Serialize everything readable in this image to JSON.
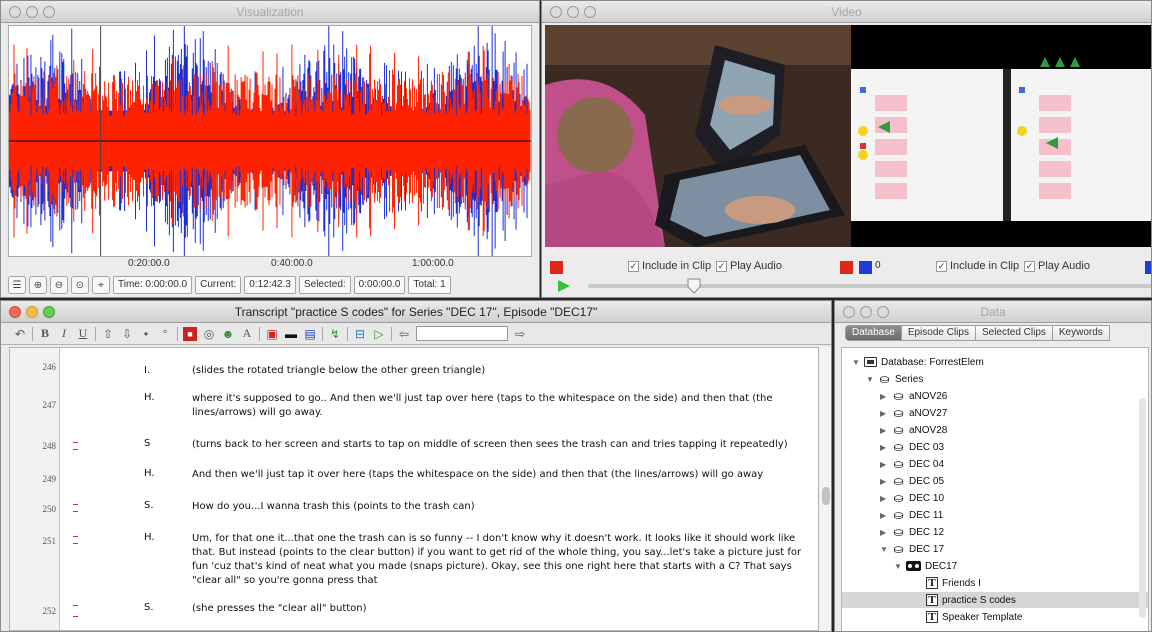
{
  "visualization": {
    "title": "Visualization",
    "ticks": [
      "0:20:00.0",
      "0:40:00.0",
      "1:00:00.0"
    ],
    "time_label": "Time: 0:00:00.0",
    "current_label": "Current:",
    "current_value": "0:12:42.3",
    "selected_label": "Selected:",
    "selected_value": "0:00:00.0",
    "total_label": "Total: 1",
    "colors": {
      "channel1": "#ff2200",
      "channel2": "#1a2fd6"
    }
  },
  "video": {
    "title": "Video",
    "include_clip": "Include in Clip",
    "play_audio": "Play Audio",
    "counter": "0",
    "colors": {
      "red": "#e1261c",
      "blue": "#1f3dd6"
    }
  },
  "transcript": {
    "title": "Transcript \"practice S codes\" for Series \"DEC 17\", Episode \"DEC17\"",
    "rows": [
      {
        "num": "246",
        "speaker": "I.",
        "text": "(slides the rotated triangle below the other green triangle)",
        "marked": false
      },
      {
        "num": "247",
        "speaker": "H.",
        "text": "where it's supposed to go.. And then we'll just tap over here (taps to the whitespace on the side) and then that (the lines/arrows) will go away.",
        "marked": false
      },
      {
        "num": "248",
        "speaker": "S",
        "text": "(turns back to her screen and starts to tap on middle of screen then sees the trash can and tries tapping it repeatedly)",
        "marked": true
      },
      {
        "num": "249",
        "speaker": "H.",
        "text": "And then we'll just tap it over here (taps the whitespace on the side) and then that (the lines/arrows) will go away",
        "marked": false
      },
      {
        "num": "250",
        "speaker": "S.",
        "text": "How do you...I wanna trash this (points to the trash can)",
        "marked": true
      },
      {
        "num": "251",
        "speaker": "H.",
        "text": "Um, for that one it...that one the trash can is so funny -- I don't know why it doesn't work.  It looks like it should work like that.  But instead (points to the clear button) if you want to get rid of the whole thing, you say...let's take a picture just for fun 'cuz that's kind of neat what you made (snaps picture). Okay, see this one right here that starts with a C? That says \"clear all\" so you're gonna press that",
        "marked": true
      },
      {
        "num": "252",
        "speaker": "S.",
        "text": "(she presses the \"clear all\" button)",
        "marked": true
      }
    ]
  },
  "data": {
    "title": "Data",
    "tabs": [
      "Database",
      "Episode Clips",
      "Selected Clips",
      "Keywords"
    ],
    "database": "Database: ForrestElem",
    "series_root": "Series",
    "series": [
      "aNOV26",
      "aNOV27",
      "aNOV28",
      "DEC 03",
      "DEC 04",
      "DEC 05",
      "DEC 10",
      "DEC 11",
      "DEC 12",
      "DEC 17"
    ],
    "episode": "DEC17",
    "transcripts": [
      "Friends I",
      "practice S codes",
      "Speaker Template"
    ]
  }
}
